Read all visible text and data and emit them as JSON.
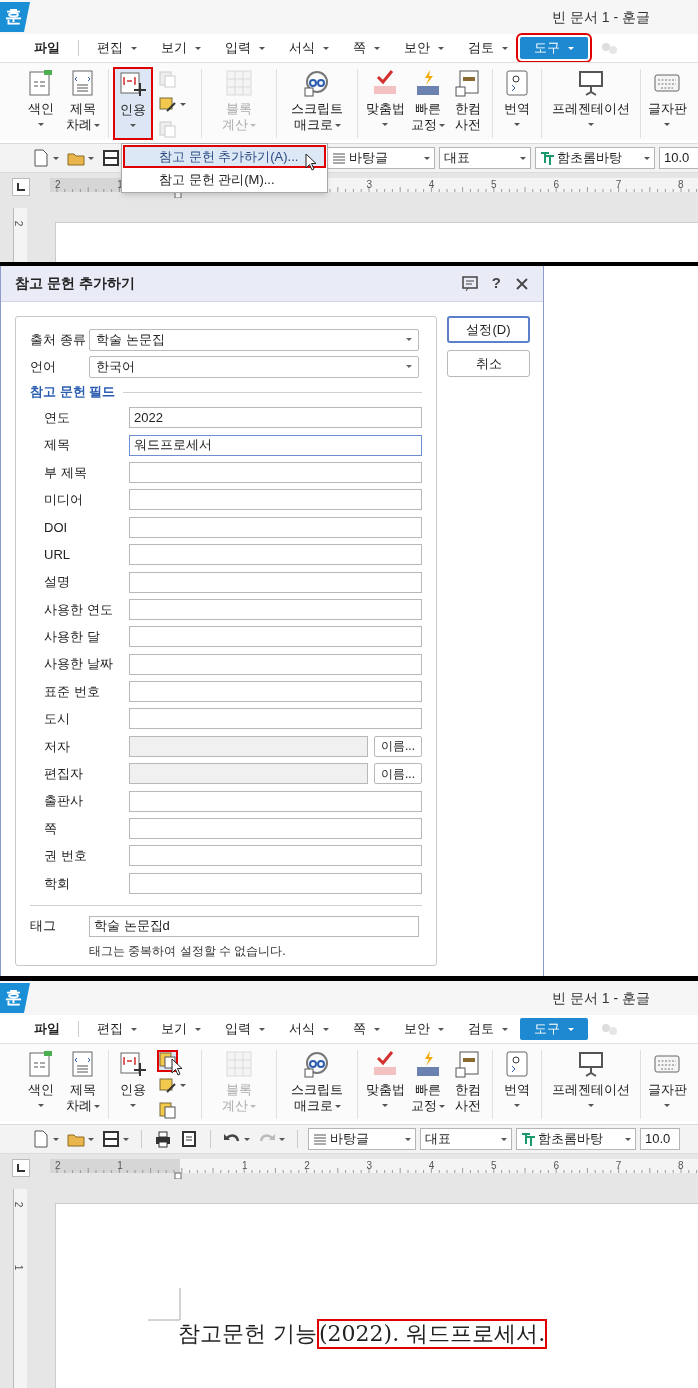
{
  "top_app": {
    "logo": "훈",
    "title": "빈 문서 1 - 훈글",
    "menu_tabs": [
      {
        "label": "파일",
        "selected": false,
        "dropdown": false
      },
      {
        "label": "편집",
        "selected": false,
        "dropdown": true
      },
      {
        "label": "보기",
        "selected": false,
        "dropdown": true
      },
      {
        "label": "입력",
        "selected": false,
        "dropdown": true
      },
      {
        "label": "서식",
        "selected": false,
        "dropdown": true
      },
      {
        "label": "쪽",
        "selected": false,
        "dropdown": true
      },
      {
        "label": "보안",
        "selected": false,
        "dropdown": true
      },
      {
        "label": "검토",
        "selected": false,
        "dropdown": true
      },
      {
        "label": "도구",
        "selected": true,
        "dropdown": true,
        "annotated": true
      }
    ],
    "ribbon": [
      {
        "kind": "large",
        "lines": [
          "색인"
        ],
        "dropdown": true,
        "caret_inline": false,
        "disabled": false,
        "pressed": false,
        "annotated": false
      },
      {
        "kind": "large",
        "lines": [
          "제목",
          "차례"
        ],
        "dropdown": true,
        "caret_inline": true,
        "disabled": false,
        "pressed": false,
        "annotated": false
      },
      {
        "kind": "large",
        "lines": [
          "인용"
        ],
        "dropdown": true,
        "caret_inline": false,
        "disabled": false,
        "pressed": true,
        "annotated": true
      },
      {
        "kind": "small_stack",
        "buttons": [
          {
            "disabled": true,
            "dropdown": false,
            "annotated": false,
            "hovered": false
          },
          {
            "disabled": false,
            "dropdown": true,
            "annotated": false,
            "hovered": false
          },
          {
            "disabled": true,
            "dropdown": false,
            "annotated": false,
            "hovered": false
          }
        ]
      },
      {
        "kind": "large",
        "lines": [
          "블록",
          "계산"
        ],
        "dropdown": true,
        "caret_inline": true,
        "disabled": true,
        "pressed": false,
        "annotated": false
      },
      {
        "kind": "large",
        "lines": [
          "스크립트",
          "매크로"
        ],
        "dropdown": true,
        "caret_inline": true,
        "disabled": false,
        "pressed": false,
        "annotated": false
      },
      {
        "kind": "large",
        "lines": [
          "맞춤법"
        ],
        "dropdown": true,
        "caret_inline": false,
        "disabled": false,
        "pressed": false,
        "annotated": false
      },
      {
        "kind": "large",
        "lines": [
          "빠른",
          "교정"
        ],
        "dropdown": true,
        "caret_inline": true,
        "disabled": false,
        "pressed": false,
        "annotated": false
      },
      {
        "kind": "large",
        "lines": [
          "한컴",
          "사전"
        ],
        "dropdown": false,
        "disabled": false,
        "pressed": false,
        "annotated": false
      },
      {
        "kind": "large",
        "lines": [
          "번역"
        ],
        "dropdown": true,
        "caret_inline": false,
        "disabled": false,
        "pressed": false,
        "annotated": false
      },
      {
        "kind": "large",
        "lines": [
          "프레젠테이션"
        ],
        "dropdown": true,
        "caret_inline": false,
        "disabled": false,
        "pressed": false,
        "annotated": false
      },
      {
        "kind": "large",
        "lines": [
          "글자판"
        ],
        "dropdown": true,
        "caret_inline": false,
        "disabled": false,
        "pressed": false,
        "annotated": false
      }
    ],
    "toolbar": {
      "style": "바탕글",
      "paragraph": "대표",
      "font": "함초롬바탕",
      "size": "10.0"
    },
    "dropdown_menu": [
      {
        "label": "참고 문헌 추가하기(A)...",
        "selected": true,
        "annotated": true
      },
      {
        "label": "참고 문헌 관리(M)...",
        "selected": false,
        "annotated": false
      }
    ],
    "ruler": {
      "left_labels": [
        "2",
        "1"
      ],
      "right_labels": [
        "3",
        "4",
        "5",
        "6",
        "7",
        "8"
      ],
      "vertical_labels": [
        "2"
      ]
    }
  },
  "dialog": {
    "title": "참고 문헌 추가하기",
    "help": "?",
    "selects": [
      {
        "label": "출처 종류",
        "value": "학술 논문집"
      },
      {
        "label": "언어",
        "value": "한국어"
      }
    ],
    "section": "참고 문헌 필드",
    "fields": [
      {
        "label": "연도",
        "value": "2022",
        "focused": false,
        "disabled": false
      },
      {
        "label": "제목",
        "value": "워드프로세서",
        "focused": true,
        "disabled": false
      },
      {
        "label": "부 제목",
        "focused": false,
        "disabled": false
      },
      {
        "label": "미디어",
        "focused": false,
        "disabled": false
      },
      {
        "label": "DOI",
        "focused": false,
        "disabled": false
      },
      {
        "label": "URL",
        "focused": false,
        "disabled": false
      },
      {
        "label": "설명",
        "focused": false,
        "disabled": false
      },
      {
        "label": "사용한 연도",
        "focused": false,
        "disabled": false
      },
      {
        "label": "사용한 달",
        "focused": false,
        "disabled": false
      },
      {
        "label": "사용한 날짜",
        "focused": false,
        "disabled": false
      },
      {
        "label": "표준 번호",
        "focused": false,
        "disabled": false
      },
      {
        "label": "도시",
        "focused": false,
        "disabled": false
      },
      {
        "label": "저자",
        "focused": false,
        "disabled": true,
        "button": "이름..."
      },
      {
        "label": "편집자",
        "focused": false,
        "disabled": true,
        "button": "이름..."
      },
      {
        "label": "출판사",
        "focused": false,
        "disabled": false
      },
      {
        "label": "쪽",
        "focused": false,
        "disabled": false
      },
      {
        "label": "권 번호",
        "focused": false,
        "disabled": false
      },
      {
        "label": "학회",
        "focused": false,
        "disabled": false
      }
    ],
    "tag": {
      "label": "태그",
      "value": "학술 논문집d"
    },
    "note": "태그는 중복하여 설정할 수 없습니다.",
    "buttons": [
      {
        "label": "설정(D)",
        "default": true
      },
      {
        "label": "취소",
        "default": false
      }
    ]
  },
  "bottom_app": {
    "logo": "훈",
    "title": "빈 문서 1 - 훈글",
    "menu_tabs": [
      {
        "label": "파일",
        "selected": false,
        "dropdown": false
      },
      {
        "label": "편집",
        "selected": false,
        "dropdown": true
      },
      {
        "label": "보기",
        "selected": false,
        "dropdown": true
      },
      {
        "label": "입력",
        "selected": false,
        "dropdown": true
      },
      {
        "label": "서식",
        "selected": false,
        "dropdown": true
      },
      {
        "label": "쪽",
        "selected": false,
        "dropdown": true
      },
      {
        "label": "보안",
        "selected": false,
        "dropdown": true
      },
      {
        "label": "검토",
        "selected": false,
        "dropdown": true
      },
      {
        "label": "도구",
        "selected": true,
        "dropdown": true
      }
    ],
    "ribbon": [
      {
        "kind": "large",
        "lines": [
          "색인"
        ],
        "dropdown": true,
        "caret_inline": false,
        "disabled": false,
        "pressed": false,
        "annotated": false
      },
      {
        "kind": "large",
        "lines": [
          "제목",
          "차례"
        ],
        "dropdown": true,
        "caret_inline": true,
        "disabled": false,
        "pressed": false,
        "annotated": false
      },
      {
        "kind": "large",
        "lines": [
          "인용"
        ],
        "dropdown": true,
        "caret_inline": false,
        "disabled": false,
        "pressed": false,
        "annotated": false
      },
      {
        "kind": "small_stack",
        "buttons": [
          {
            "disabled": false,
            "dropdown": false,
            "annotated": true,
            "hovered": true
          },
          {
            "disabled": false,
            "dropdown": true,
            "annotated": false,
            "hovered": false
          },
          {
            "disabled": false,
            "dropdown": false,
            "annotated": false,
            "hovered": false
          }
        ]
      },
      {
        "kind": "large",
        "lines": [
          "블록",
          "계산"
        ],
        "dropdown": true,
        "caret_inline": true,
        "disabled": true,
        "pressed": false,
        "annotated": false
      },
      {
        "kind": "large",
        "lines": [
          "스크립트",
          "매크로"
        ],
        "dropdown": true,
        "caret_inline": true,
        "disabled": false,
        "pressed": false,
        "annotated": false
      },
      {
        "kind": "large",
        "lines": [
          "맞춤법"
        ],
        "dropdown": true,
        "caret_inline": false,
        "disabled": false,
        "pressed": false,
        "annotated": false
      },
      {
        "kind": "large",
        "lines": [
          "빠른",
          "교정"
        ],
        "dropdown": true,
        "caret_inline": true,
        "disabled": false,
        "pressed": false,
        "annotated": false
      },
      {
        "kind": "large",
        "lines": [
          "한컴",
          "사전"
        ],
        "dropdown": false,
        "disabled": false,
        "pressed": false,
        "annotated": false
      },
      {
        "kind": "large",
        "lines": [
          "번역"
        ],
        "dropdown": true,
        "caret_inline": false,
        "disabled": false,
        "pressed": false,
        "annotated": false
      },
      {
        "kind": "large",
        "lines": [
          "프레젠테이션"
        ],
        "dropdown": true,
        "caret_inline": false,
        "disabled": false,
        "pressed": false,
        "annotated": false
      },
      {
        "kind": "large",
        "lines": [
          "글자판"
        ],
        "dropdown": true,
        "caret_inline": false,
        "disabled": false,
        "pressed": false,
        "annotated": false
      }
    ],
    "toolbar": {
      "style": "바탕글",
      "paragraph": "대표",
      "font": "함초롬바탕",
      "size": "10.0"
    },
    "ruler": {
      "left_labels": [
        "2",
        "1"
      ],
      "right_labels": [
        "1",
        "2",
        "3",
        "4",
        "5",
        "6",
        "7",
        "8"
      ],
      "vertical_labels": [
        "2",
        "1"
      ]
    },
    "document": {
      "text": "참고문헌 기능",
      "citation": "(2022). 워드프로세서.",
      "citation_annotated": true
    }
  }
}
